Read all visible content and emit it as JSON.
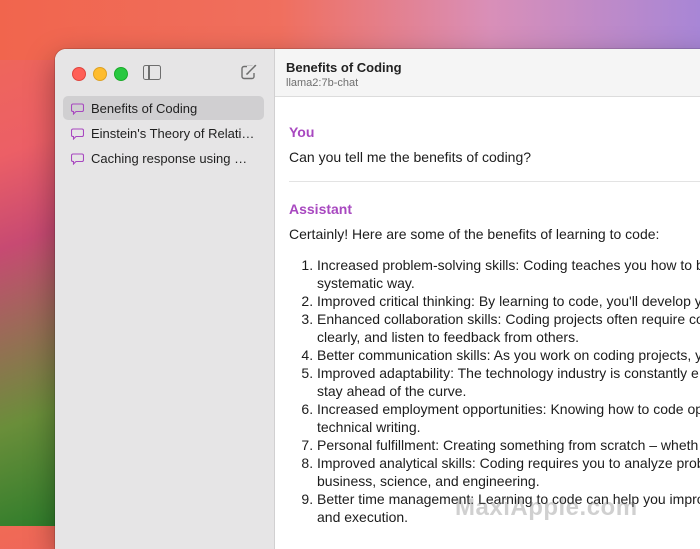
{
  "app": {
    "sidebar": {
      "chats": [
        {
          "label": "Benefits of Coding",
          "active": true
        },
        {
          "label": "Einstein's Theory of Relativity",
          "active": false
        },
        {
          "label": "Caching response using NS…",
          "active": false
        }
      ]
    },
    "header": {
      "title": "Benefits of Coding",
      "model": "llama2:7b-chat"
    },
    "conversation": {
      "user_role": "You",
      "user_message": "Can you tell me the benefits of coding?",
      "assistant_role": "Assistant",
      "assistant_intro": "Certainly! Here are some of the benefits of learning to code:",
      "items": [
        {
          "line1": "Increased problem-solving skills: Coding teaches you how to b",
          "line2": "systematic way."
        },
        {
          "line1": "Improved critical thinking: By learning to code, you'll develop y",
          "line2": ""
        },
        {
          "line1": "Enhanced collaboration skills: Coding projects often require co",
          "line2": "clearly, and listen to feedback from others."
        },
        {
          "line1": "Better communication skills: As you work on coding projects, y",
          "line2": ""
        },
        {
          "line1": "Improved adaptability: The technology industry is constantly e",
          "line2": "stay ahead of the curve."
        },
        {
          "line1": "Increased employment opportunities: Knowing how to code op",
          "line2": "technical writing."
        },
        {
          "line1": "Personal fulfillment: Creating something from scratch – wheth",
          "line2": ""
        },
        {
          "line1": "Improved analytical skills: Coding requires you to analyze prob",
          "line2": "business, science, and engineering."
        },
        {
          "line1": "Better time management: Learning to code can help you impro",
          "line2": "and execution."
        }
      ]
    },
    "watermark": "MaxiApple.com",
    "colors": {
      "accent": "#a848c0",
      "sidebar_bg": "#e6e5e6",
      "selected_bg": "#d0cfd1"
    }
  }
}
